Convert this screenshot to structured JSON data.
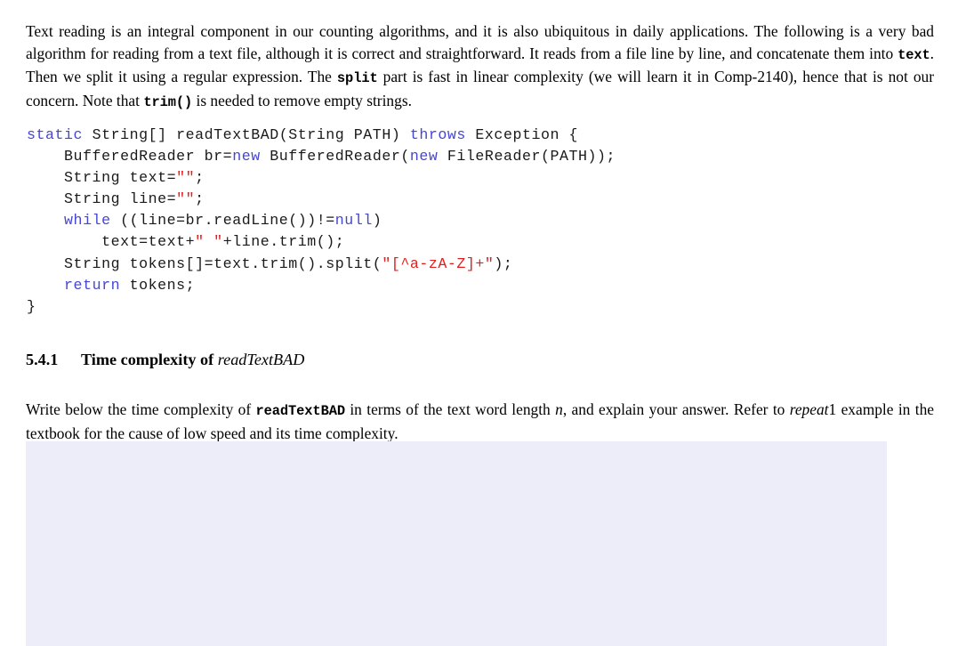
{
  "document": {
    "intro_paragraph": {
      "seg1": "Text reading is an integral component in our counting algorithms, and it is also ubiquitous in daily applications. The following is a very bad algorithm for reading from a text file, although it is correct and straightforward. It reads from a file line by line, and concatenate them into ",
      "code1": "text",
      "seg2": ". Then we split it using a regular expression. The ",
      "code2": "split",
      "seg3": " part is fast in linear complexity (we will learn it in Comp-2140), hence that is not our concern. Note that ",
      "code3": "trim()",
      "seg4": " is needed to remove empty strings."
    },
    "code_block": {
      "language": "java",
      "lines": [
        {
          "tokens": [
            {
              "text": "static",
              "type": "keyword"
            },
            {
              "text": " String[] readTextBAD(String PATH) ",
              "type": "plain"
            },
            {
              "text": "throws",
              "type": "keyword"
            },
            {
              "text": " Exception {",
              "type": "plain"
            }
          ]
        },
        {
          "tokens": [
            {
              "text": "    BufferedReader br=",
              "type": "plain"
            },
            {
              "text": "new",
              "type": "keyword"
            },
            {
              "text": " BufferedReader(",
              "type": "plain"
            },
            {
              "text": "new",
              "type": "keyword"
            },
            {
              "text": " FileReader(PATH));",
              "type": "plain"
            }
          ]
        },
        {
          "tokens": [
            {
              "text": "    String text=",
              "type": "plain"
            },
            {
              "text": "\"\"",
              "type": "string"
            },
            {
              "text": ";",
              "type": "plain"
            }
          ]
        },
        {
          "tokens": [
            {
              "text": "    String line=",
              "type": "plain"
            },
            {
              "text": "\"\"",
              "type": "string"
            },
            {
              "text": ";",
              "type": "plain"
            }
          ]
        },
        {
          "tokens": [
            {
              "text": "    ",
              "type": "plain"
            },
            {
              "text": "while",
              "type": "keyword"
            },
            {
              "text": " ((line=br.readLine())!=",
              "type": "plain"
            },
            {
              "text": "null",
              "type": "keyword"
            },
            {
              "text": ")",
              "type": "plain"
            }
          ]
        },
        {
          "tokens": [
            {
              "text": "        text=text+",
              "type": "plain"
            },
            {
              "text": "\" \"",
              "type": "string"
            },
            {
              "text": "+line.trim();",
              "type": "plain"
            }
          ]
        },
        {
          "tokens": [
            {
              "text": "    String tokens[]=text.trim().split(",
              "type": "plain"
            },
            {
              "text": "\"[^a-zA-Z]+\"",
              "type": "string"
            },
            {
              "text": ");",
              "type": "plain"
            }
          ]
        },
        {
          "tokens": [
            {
              "text": "    ",
              "type": "plain"
            },
            {
              "text": "return",
              "type": "keyword"
            },
            {
              "text": " tokens;",
              "type": "plain"
            }
          ]
        },
        {
          "tokens": [
            {
              "text": "}",
              "type": "plain"
            }
          ]
        }
      ]
    },
    "subsection": {
      "number": "5.4.1",
      "title_prefix": "Time complexity of ",
      "title_math": "readTextBAD"
    },
    "question_paragraph": {
      "seg1": "Write below the time complexity of ",
      "code1": "readTextBAD",
      "seg2": " in terms of the text word length ",
      "math1": "n",
      "seg3": ", and explain your answer. Refer to ",
      "math2": "repeat",
      "seg4": "1 example in the textbook for the cause of low speed and its time complexity."
    },
    "answer_box": {
      "value": "",
      "placeholder": "",
      "fill_color": "#ecedf9"
    },
    "colors": {
      "keyword": "#4646cf",
      "string": "#e02020",
      "code_text": "#1a1a1a",
      "body_text": "#000000",
      "answer_box": "#ecedf9",
      "page_background": "#ffffff"
    }
  }
}
